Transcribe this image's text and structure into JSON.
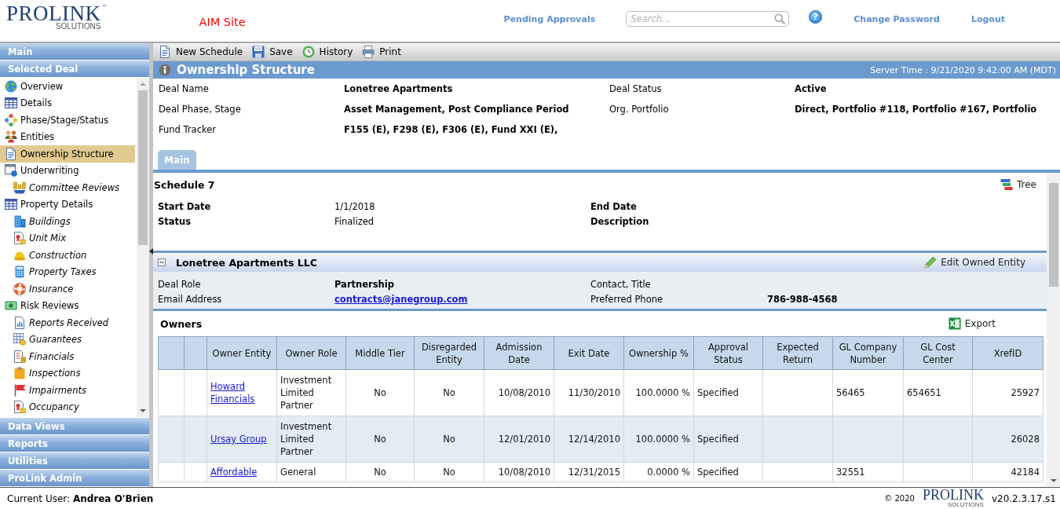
{
  "header": {
    "logo": {
      "name": "PROLINK",
      "trademark": "™",
      "tagline": "SOLUTIONS"
    },
    "site_label": "AIM Site",
    "links": [
      {
        "kind": "link",
        "label": "Pending Approvals"
      },
      {
        "kind": "search",
        "placeholder": "Search..."
      },
      {
        "kind": "help",
        "label": "?"
      },
      {
        "kind": "link",
        "label": "Change Password"
      },
      {
        "kind": "link",
        "label": "Logout"
      }
    ]
  },
  "sidebar": {
    "sections": [
      {
        "title": "Main"
      },
      {
        "title": "Selected Deal",
        "items": [
          {
            "label": "Overview",
            "selected": false
          },
          {
            "label": "Details",
            "selected": false
          },
          {
            "label": "Phase/Stage/Status",
            "selected": false
          },
          {
            "label": "Entities",
            "selected": false
          },
          {
            "label": "Ownership Structure",
            "selected": true
          },
          {
            "label": "Underwriting",
            "selected": false,
            "children": [
              {
                "label": "Committee Reviews",
                "selected": false
              }
            ]
          },
          {
            "label": "Property Details",
            "selected": false,
            "children": [
              {
                "label": "Buildings",
                "selected": false
              },
              {
                "label": "Unit Mix",
                "selected": false
              },
              {
                "label": "Construction",
                "selected": false
              },
              {
                "label": "Property Taxes",
                "selected": false
              },
              {
                "label": "Insurance",
                "selected": false
              }
            ]
          },
          {
            "label": "Risk Reviews",
            "selected": false,
            "children": [
              {
                "label": "Reports Received",
                "selected": false
              },
              {
                "label": "Guarantees",
                "selected": false
              },
              {
                "label": "Financials",
                "selected": false
              },
              {
                "label": "Inspections",
                "selected": false
              },
              {
                "label": "Impairments",
                "selected": false
              },
              {
                "label": "Occupancy",
                "selected": false
              }
            ]
          }
        ]
      },
      {
        "title": "Data Views"
      },
      {
        "title": "Reports"
      },
      {
        "title": "Utilities"
      },
      {
        "title": "ProLink Admin"
      }
    ]
  },
  "toolbar": [
    {
      "label": "New Schedule"
    },
    {
      "label": "Save"
    },
    {
      "label": "History"
    },
    {
      "label": "Print"
    }
  ],
  "page_header": {
    "title": "Ownership Structure",
    "server_time": "Server Time : 9/21/2020 9:42:00 AM (MDT)"
  },
  "deal_summary": [
    {
      "label": "Deal Name",
      "value": "Lonetree Apartments"
    },
    {
      "label": "Deal Status",
      "value": "Active"
    },
    {
      "label": "Deal Phase, Stage",
      "value": "Asset Management, Post Compliance Period"
    },
    {
      "label": "Org. Portfolio",
      "value": "Direct, Portfolio #118, Portfolio #167, Portfolio"
    },
    {
      "label": "Fund Tracker",
      "value": "F155 (E), F298 (E), F306 (E), Fund XXI (E),"
    }
  ],
  "tabs": [
    {
      "label": "Main",
      "selected": true
    }
  ],
  "schedule": {
    "title": "Schedule 7",
    "tree_button": "Tree",
    "fields": [
      {
        "label": "Start Date",
        "value": "1/1/2018"
      },
      {
        "label": "End Date"
      },
      {
        "label": "Status",
        "value": "Finalized"
      },
      {
        "label": "Description"
      }
    ]
  },
  "entity": {
    "name": "Lonetree Apartments LLC",
    "expanded": true,
    "edit_button": "Edit Owned Entity",
    "fields": [
      {
        "label": "Deal Role",
        "value": "Partnership"
      },
      {
        "label": "Contact, Title"
      },
      {
        "label": "Email Address",
        "value": "contracts@janegroup.com",
        "kind": "link"
      },
      {
        "label": "Preferred Phone",
        "value": "786-988-4568"
      }
    ]
  },
  "owners": {
    "title": "Owners",
    "export_button": "Export",
    "table": {
      "columns": [
        {},
        {},
        {
          "heading": "Owner Entity"
        },
        {
          "heading": "Owner Role"
        },
        {
          "heading": "Middle Tier"
        },
        {
          "heading": "Disregarded Entity"
        },
        {
          "heading": "Admission Date"
        },
        {
          "heading": "Exit Date"
        },
        {
          "heading": "Ownership %"
        },
        {
          "heading": "Approval Status"
        },
        {
          "heading": "Expected Return"
        },
        {
          "heading": "GL Company Number"
        },
        {
          "heading": "GL Cost Center"
        },
        {
          "heading": "XrefID"
        }
      ],
      "rows": [
        {
          "cells": [
            {},
            {},
            {
              "text": "Howard Financials",
              "kind": "link"
            },
            {
              "text": "Investment Limited Partner"
            },
            {
              "text": "No"
            },
            {
              "text": "No"
            },
            {
              "text": "10/08/2010"
            },
            {
              "text": "11/30/2010"
            },
            {
              "text": "100.0000 %"
            },
            {
              "text": "Specified"
            },
            {},
            {
              "text": "56465"
            },
            {
              "text": "654651"
            },
            {
              "text": "25927"
            }
          ]
        },
        {
          "cells": [
            {},
            {},
            {
              "text": "Ursay Group",
              "kind": "link"
            },
            {
              "text": "Investment Limited Partner"
            },
            {
              "text": "No"
            },
            {
              "text": "No"
            },
            {
              "text": "12/01/2010"
            },
            {
              "text": "12/14/2010"
            },
            {
              "text": "100.0000 %"
            },
            {
              "text": "Specified"
            },
            {},
            {},
            {},
            {
              "text": "26028"
            }
          ]
        },
        {
          "cells": [
            {},
            {},
            {
              "text": "Affordable",
              "kind": "link"
            },
            {
              "text": "General"
            },
            {
              "text": "No"
            },
            {
              "text": "No"
            },
            {
              "text": "10/08/2010"
            },
            {
              "text": "12/31/2015"
            },
            {
              "text": "0.0000 %"
            },
            {
              "text": "Specified"
            },
            {},
            {
              "text": "32551"
            },
            {},
            {
              "text": "42184"
            }
          ]
        }
      ]
    }
  },
  "footer": {
    "current_user": "Current User: **Andrea O'Brien**",
    "copyright": "© 2020",
    "logo": {
      "name": "PROLINK",
      "tagline": "SOLUTIONS"
    },
    "version": "v20.2.3.17.s1"
  }
}
